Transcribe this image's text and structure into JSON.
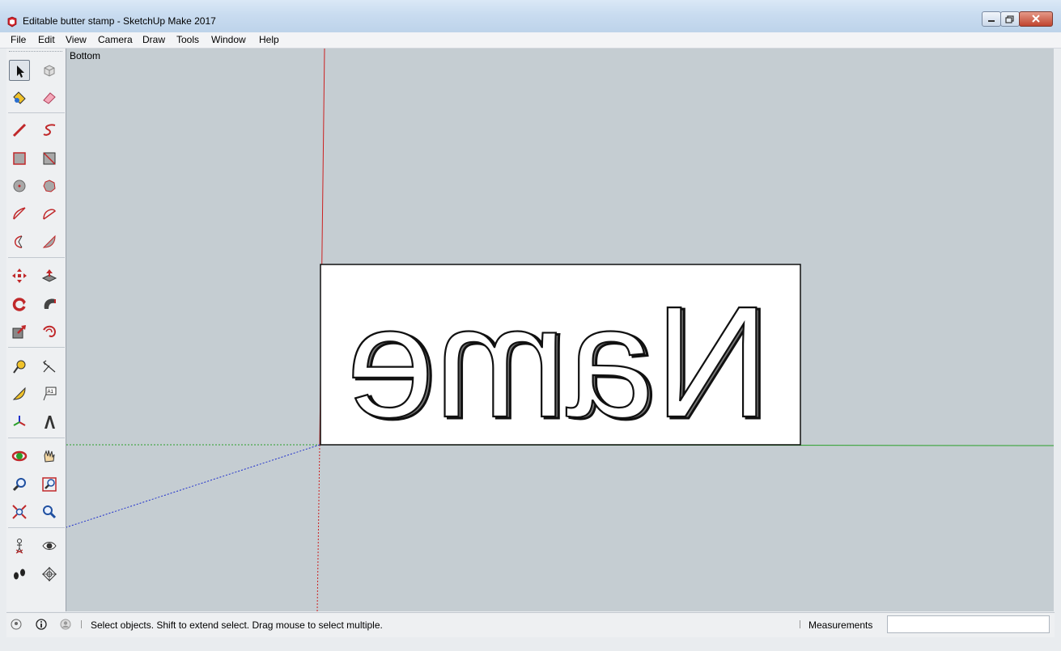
{
  "window": {
    "title": "Editable butter stamp - SketchUp Make 2017"
  },
  "menu": [
    {
      "label": "File"
    },
    {
      "label": "Edit"
    },
    {
      "label": "View"
    },
    {
      "label": "Camera"
    },
    {
      "label": "Draw"
    },
    {
      "label": "Tools"
    },
    {
      "label": "Window"
    },
    {
      "label": "Help"
    }
  ],
  "viewport": {
    "scene_label": "Bottom",
    "stamp_text": "Name",
    "stamp_mirrored": true,
    "colors": {
      "background": "#c5cdd2",
      "red_axis": "#cc2020",
      "green_axis": "#2aa02a",
      "blue_axis": "#2030cc",
      "stamp_face": "#ffffff"
    }
  },
  "toolbar": {
    "tools": [
      "select-icon",
      "make-component-icon",
      "paint-bucket-icon",
      "eraser-icon",
      "line-icon",
      "freehand-icon",
      "rectangle-icon",
      "rotated-rectangle-icon",
      "circle-icon",
      "polygon-icon",
      "arc-icon",
      "two-point-arc-icon",
      "three-point-arc-icon",
      "pie-icon",
      "move-icon",
      "push-pull-icon",
      "rotate-icon",
      "follow-me-icon",
      "scale-icon",
      "offset-icon",
      "tape-measure-icon",
      "dimension-icon",
      "protractor-icon",
      "text-icon",
      "axes-icon",
      "3d-text-icon",
      "orbit-icon",
      "pan-icon",
      "zoom-icon",
      "zoom-window-icon",
      "zoom-extents-icon",
      "previous-view-icon",
      "position-camera-icon",
      "look-around-icon",
      "walk-icon",
      "section-plane-icon"
    ]
  },
  "status": {
    "message": "Select objects. Shift to extend select. Drag mouse to select multiple.",
    "measurements_label": "Measurements",
    "measurements_value": ""
  }
}
